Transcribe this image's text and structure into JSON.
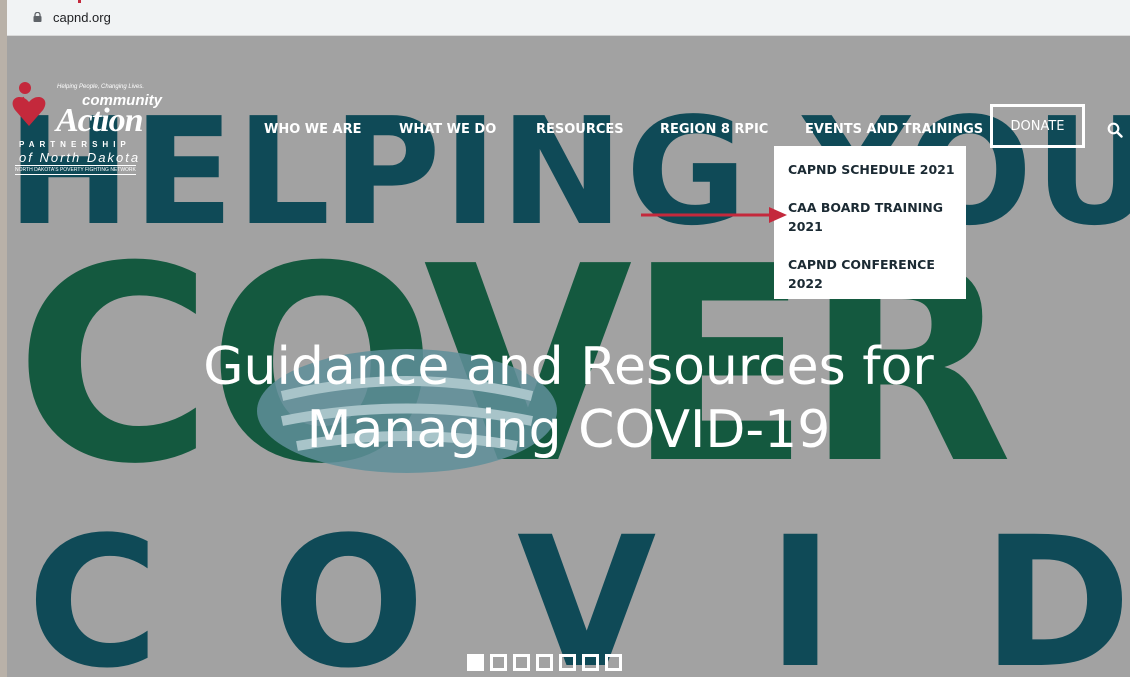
{
  "browser": {
    "url": "capnd.org"
  },
  "logo": {
    "tagline": "Helping People, Changing Lives.",
    "line1": "community",
    "line2": "Action",
    "line3": "PARTNERSHIP",
    "line4": "of North Dakota",
    "line5": "NORTH DAKOTA'S POVERTY FIGHTING NETWORK"
  },
  "nav": {
    "items": [
      {
        "label": "WHO WE ARE"
      },
      {
        "label": "WHAT WE DO"
      },
      {
        "label": "RESOURCES"
      },
      {
        "label": "REGION 8 RPIC"
      },
      {
        "label": "EVENTS AND TRAININGS"
      }
    ],
    "donate_label": "DONATE"
  },
  "dropdown": {
    "items": [
      {
        "label": "CAPND SCHEDULE 2021"
      },
      {
        "label": "CAA BOARD TRAINING 2021"
      },
      {
        "label": "CAPND CONFERENCE 2022"
      }
    ]
  },
  "hero": {
    "word1": "HELPING YOU",
    "word2": "COVER",
    "word3_letters": [
      "C",
      "O",
      "V",
      "I",
      "D"
    ],
    "headline_line1": "Guidance and Resources for",
    "headline_line2": "Managing COVID-19"
  },
  "slider": {
    "count": 7,
    "active_index": 0
  },
  "colors": {
    "teal": "#0f4a57",
    "green": "#14593f",
    "annotation_red": "#c4293c",
    "hero_bg": "#a2a2a2"
  }
}
